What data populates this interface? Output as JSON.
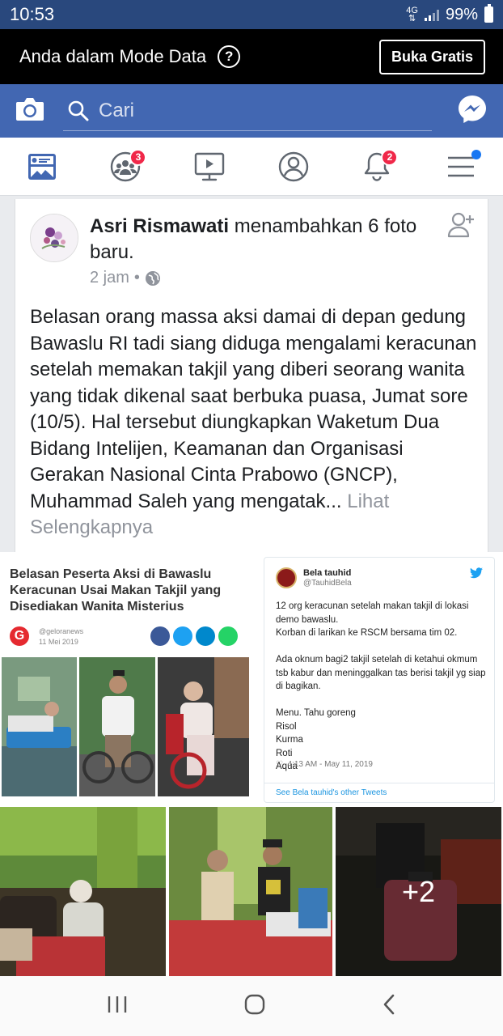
{
  "status": {
    "time": "10:53",
    "network": "4G",
    "battery": "99%"
  },
  "data_mode": {
    "label": "Anda dalam Mode Data",
    "help_icon": "?",
    "button": "Buka Gratis"
  },
  "search": {
    "placeholder": "Cari"
  },
  "nav": {
    "friends_badge": "3",
    "notifications_badge": "2"
  },
  "post": {
    "author": "Asri Rismawati",
    "action": " menambahkan 6 foto baru.",
    "time": "2 jam",
    "separator": "•",
    "body": "Belasan orang massa aksi damai di depan gedung Bawaslu RI tadi siang diduga mengalami keracunan setelah memakan takjil yang diberi seorang wanita yang tidak dikenal saat berbuka puasa, Jumat sore (10/5). Hal tersebut diungkapkan Waketum Dua Bidang Intelijen, Keamanan dan Organisasi Gerakan Nasional Cinta Prabowo (GNCP), Muhammad Saleh yang mengatak...",
    "see_more": "Lihat Selengkapnya"
  },
  "photo1": {
    "headline": "Belasan Peserta Aksi di Bawaslu Keracunan Usai Makan Takjil yang Disediakan Wanita Misterius",
    "source": "@geloranews",
    "date": "11 Mei 2019"
  },
  "tweet": {
    "name": "Bela tauhid",
    "handle": "@TauhidBela",
    "text": "12 org keracunan setelah makan takjil di lokasi demo bawaslu.\nKorban di larikan ke RSCM bersama tim 02.\n\nAda oknum bagi2 takjil setelah di ketahui okmum tsb kabur dan meninggalkan tas berisi takjil yg siap di bagikan.\n\nMenu. Tahu goreng\nRisol\nKurma\nRoti\nAqua",
    "time": "4:13 AM - May 11, 2019",
    "footer": "See Bela tauhid's other Tweets"
  },
  "more_photos": "+2",
  "colors": {
    "fb_blue": "#4267b2",
    "status_blue": "#29487d",
    "badge_red": "#f02849",
    "dot_blue": "#1877f2"
  }
}
